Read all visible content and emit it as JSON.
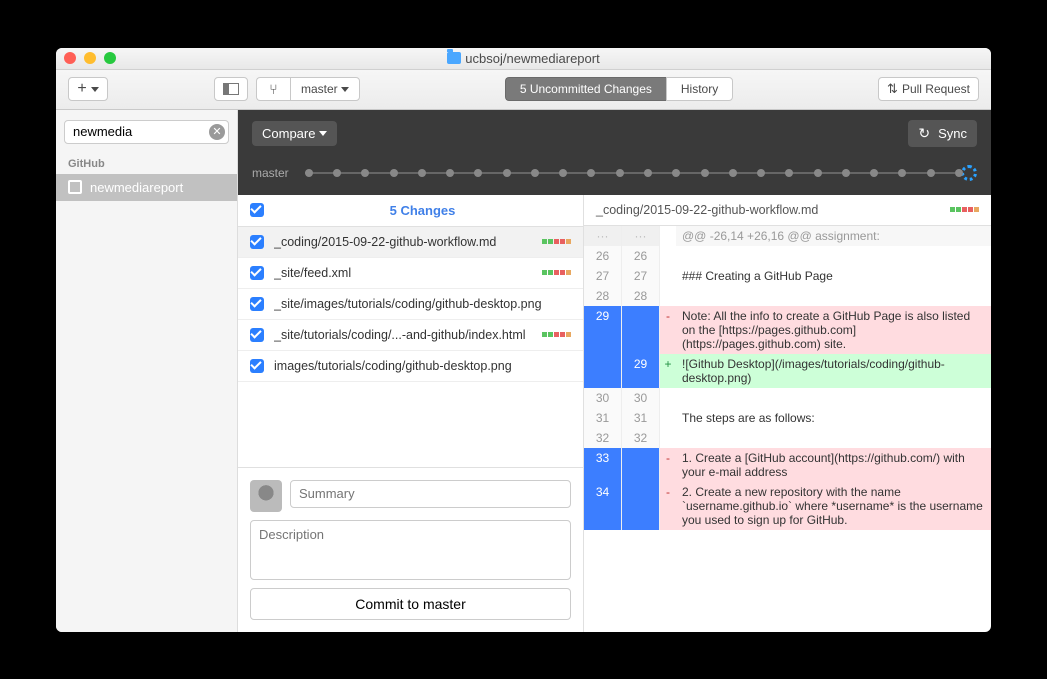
{
  "title": "ucbsoj/newmediareport",
  "toolbar": {
    "branch": "master",
    "tabs": {
      "changes": "5 Uncommitted Changes",
      "history": "History"
    },
    "pull_request": "Pull Request"
  },
  "sidebar": {
    "search_value": "newmedia",
    "section": "GitHub",
    "repo": "newmediareport"
  },
  "darkbar": {
    "compare": "Compare",
    "sync": "Sync"
  },
  "timeline": {
    "branch": "master"
  },
  "changes": {
    "header": "5 Changes",
    "files": [
      {
        "name": "_coding/2015-09-22-github-workflow.md",
        "dots": [
          "g",
          "g",
          "r",
          "r",
          "o"
        ],
        "selected": true
      },
      {
        "name": "_site/feed.xml",
        "dots": [
          "g",
          "g",
          "r",
          "r",
          "o"
        ]
      },
      {
        "name": "_site/images/tutorials/coding/github-desktop.png",
        "dots": []
      },
      {
        "name": "_site/tutorials/coding/...-and-github/index.html",
        "dots": [
          "g",
          "g",
          "r",
          "r",
          "o"
        ]
      },
      {
        "name": "images/tutorials/coding/github-desktop.png",
        "dots": []
      }
    ]
  },
  "commit": {
    "summary_placeholder": "Summary",
    "description_placeholder": "Description",
    "button": "Commit to master"
  },
  "diff": {
    "file": "_coding/2015-09-22-github-workflow.md",
    "hunk": "@@ -26,14 +26,16 @@ assignment:",
    "lines": [
      {
        "old": "26",
        "new": "26",
        "t": "ctx",
        "text": ""
      },
      {
        "old": "27",
        "new": "27",
        "t": "ctx",
        "text": "### Creating a GitHub Page"
      },
      {
        "old": "28",
        "new": "28",
        "t": "ctx",
        "text": ""
      },
      {
        "old": "29",
        "new": "",
        "t": "del",
        "text": "Note: All the info to create a GitHub Page is also listed on the [https://pages.github.com](https://pages.github.com) site."
      },
      {
        "old": "",
        "new": "29",
        "t": "add",
        "text": "![Github Desktop](/images/tutorials/coding/github-desktop.png)"
      },
      {
        "old": "30",
        "new": "30",
        "t": "ctx",
        "text": ""
      },
      {
        "old": "31",
        "new": "31",
        "t": "ctx",
        "text": "The steps are as follows:"
      },
      {
        "old": "32",
        "new": "32",
        "t": "ctx",
        "text": ""
      },
      {
        "old": "33",
        "new": "",
        "t": "del",
        "text": "1. Create a [GitHub account](https://github.com/) with your e-mail address"
      },
      {
        "old": "34",
        "new": "",
        "t": "del",
        "text": "2. Create a new repository with the name `username.github.io` where *username* is the username you used to sign up for GitHub."
      }
    ]
  }
}
